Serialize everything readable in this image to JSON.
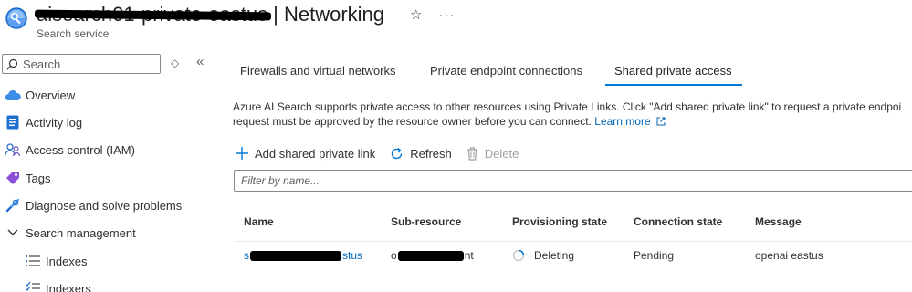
{
  "header": {
    "title_redacted": "aisearch01-private-eastus",
    "title_separator": " | ",
    "title": "Networking",
    "subtitle": "Search service",
    "star_icon": "☆",
    "more_icon": "···"
  },
  "sidebar": {
    "search_placeholder": "Search",
    "updown_icon": "◇",
    "collapse_icon": "«",
    "items": [
      {
        "label": "Overview",
        "icon": "cloud-icon"
      },
      {
        "label": "Activity log",
        "icon": "activity-log-icon"
      },
      {
        "label": "Access control (IAM)",
        "icon": "people-icon"
      },
      {
        "label": "Tags",
        "icon": "tag-icon"
      },
      {
        "label": "Diagnose and solve problems",
        "icon": "wrench-icon"
      },
      {
        "label": "Search management",
        "icon": "chevron-down-icon"
      },
      {
        "label": "Indexes",
        "icon": "list-icon"
      },
      {
        "label": "Indexers",
        "icon": "indexer-icon"
      }
    ]
  },
  "tabs": [
    {
      "label": "Firewalls and virtual networks"
    },
    {
      "label": "Private endpoint connections"
    },
    {
      "label": "Shared private access",
      "active": true
    }
  ],
  "description": {
    "line1": "Azure AI Search supports private access to other resources using Private Links. Click \"Add shared private link\" to request a private endpoi",
    "line2": "request must be approved by the resource owner before you can connect.",
    "learn_more": "Learn more"
  },
  "toolbar": {
    "add": "Add shared private link",
    "refresh": "Refresh",
    "delete": "Delete"
  },
  "filter": {
    "placeholder": "Filter by name..."
  },
  "table": {
    "columns": [
      "Name",
      "Sub-resource",
      "Provisioning state",
      "Connection state",
      "Message"
    ],
    "rows": [
      {
        "name_prefix": "s",
        "name_suffix": "stus",
        "subresource_prefix": "o",
        "subresource_suffix": "nt",
        "provisioning_state": "Deleting",
        "connection_state": "Pending",
        "message": "openai eastus"
      }
    ]
  },
  "colors": {
    "accent": "#0078d4",
    "link": "#0066b8"
  }
}
